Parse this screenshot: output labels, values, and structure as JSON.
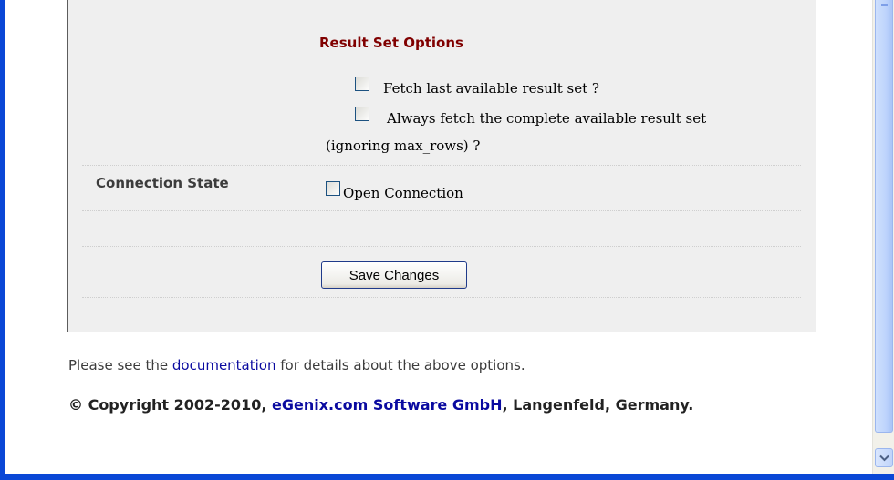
{
  "form": {
    "result_set_title": "Result Set Options",
    "option_fetch_last": "Fetch last available result set ?",
    "option_fetch_complete_line1": "Always fetch the complete available result set",
    "option_fetch_complete_line2": "(ignoring max_rows) ?",
    "connection_state_label": "Connection State",
    "option_open_connection": "Open Connection",
    "save_button_label": "Save Changes"
  },
  "footer": {
    "note_before": "Please see the ",
    "note_link": "documentation",
    "note_after": " for details about the above options.",
    "copyright_before": "© Copyright 2002-2010, ",
    "copyright_link": "eGenix.com Software GmbH",
    "copyright_after": ", Langenfeld, Germany."
  },
  "colors": {
    "frame": "#0a47d6",
    "section_title": "#800000",
    "link": "#0a0aa0",
    "panel_bg": "#efefef"
  }
}
